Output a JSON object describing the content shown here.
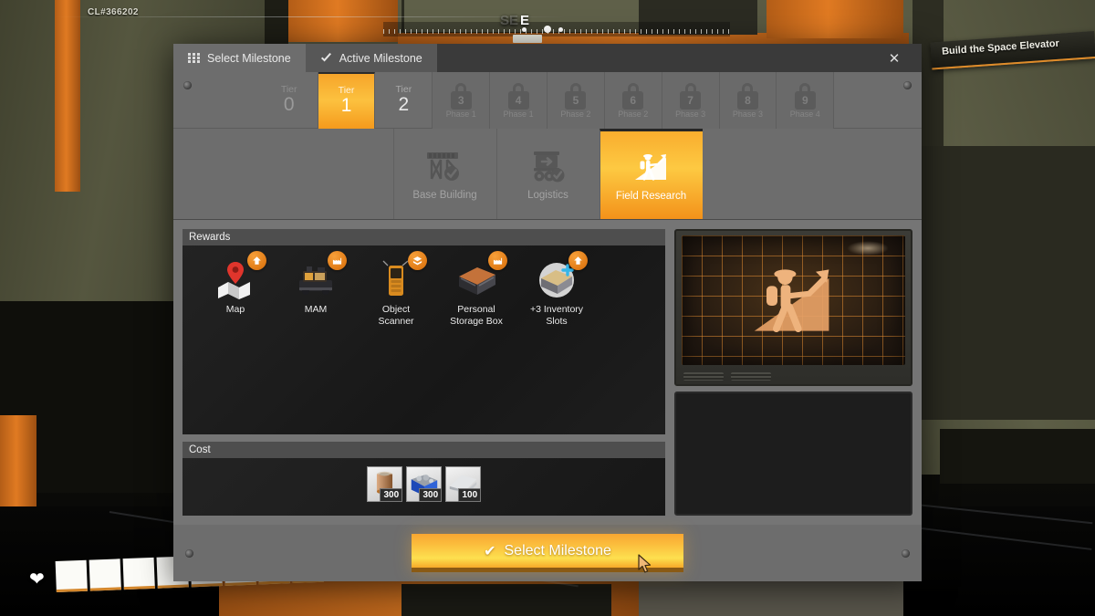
{
  "hud": {
    "session_code": "CL#366202",
    "objective": "Build the Space Elevator",
    "compass_letter": "E",
    "compass_letter_ghost": "SE"
  },
  "window": {
    "tabs": [
      {
        "label": "Select Milestone",
        "icon": "grid-icon",
        "active": true
      },
      {
        "label": "Active Milestone",
        "icon": "check-icon",
        "active": false
      }
    ],
    "close_label": "✕"
  },
  "tiers": [
    {
      "label": "Tier",
      "number": "0",
      "state": "available",
      "phase": ""
    },
    {
      "label": "Tier",
      "number": "1",
      "state": "selected",
      "phase": ""
    },
    {
      "label": "Tier",
      "number": "2",
      "state": "available",
      "phase": ""
    },
    {
      "label": "Tier",
      "number": "3",
      "state": "locked",
      "phase": "Phase 1"
    },
    {
      "label": "Tier",
      "number": "4",
      "state": "locked",
      "phase": "Phase 1"
    },
    {
      "label": "Tier",
      "number": "5",
      "state": "locked",
      "phase": "Phase 2"
    },
    {
      "label": "Tier",
      "number": "6",
      "state": "locked",
      "phase": "Phase 2"
    },
    {
      "label": "Tier",
      "number": "7",
      "state": "locked",
      "phase": "Phase 3"
    },
    {
      "label": "Tier",
      "number": "8",
      "state": "locked",
      "phase": "Phase 3"
    },
    {
      "label": "Tier",
      "number": "9",
      "state": "locked",
      "phase": "Phase 4"
    }
  ],
  "categories": [
    {
      "label": "Base Building",
      "icon": "conveyor-support-icon",
      "selected": false
    },
    {
      "label": "Logistics",
      "icon": "container-truck-icon",
      "selected": false
    },
    {
      "label": "Field Research",
      "icon": "explorer-chart-icon",
      "selected": true
    }
  ],
  "rewards": {
    "section_title": "Rewards",
    "items": [
      {
        "name": "Map",
        "icon": "map-pin-icon",
        "badge": "upgrade-arrow-icon"
      },
      {
        "name": "MAM",
        "icon": "mam-machine-icon",
        "badge": "factory-icon"
      },
      {
        "name": "Object Scanner",
        "icon": "object-scanner-icon",
        "badge": "inventory-icon"
      },
      {
        "name": "Personal Storage Box",
        "icon": "storage-box-icon",
        "badge": "factory-icon"
      },
      {
        "name": "+3 Inventory Slots",
        "icon": "inventory-slots-icon",
        "badge": "upgrade-arrow-icon"
      }
    ]
  },
  "cost": {
    "section_title": "Cost",
    "items": [
      {
        "name": "Wire",
        "quantity": "300",
        "icon": "wire-spool-icon"
      },
      {
        "name": "Iron Ore",
        "quantity": "300",
        "icon": "ore-bin-icon"
      },
      {
        "name": "Iron Plate",
        "quantity": "100",
        "icon": "iron-plate-icon"
      }
    ]
  },
  "preview": {
    "icon": "explorer-chart-large-icon"
  },
  "footer": {
    "confirm_label": "Select Milestone",
    "confirm_icon": "check-icon"
  },
  "colors": {
    "accent_orange": "#f9a631",
    "accent_yellow": "#fde04f",
    "panel_gray": "#6d6d6d",
    "panel_dark": "#1e1e1e",
    "badge_orange": "#e07b16"
  }
}
